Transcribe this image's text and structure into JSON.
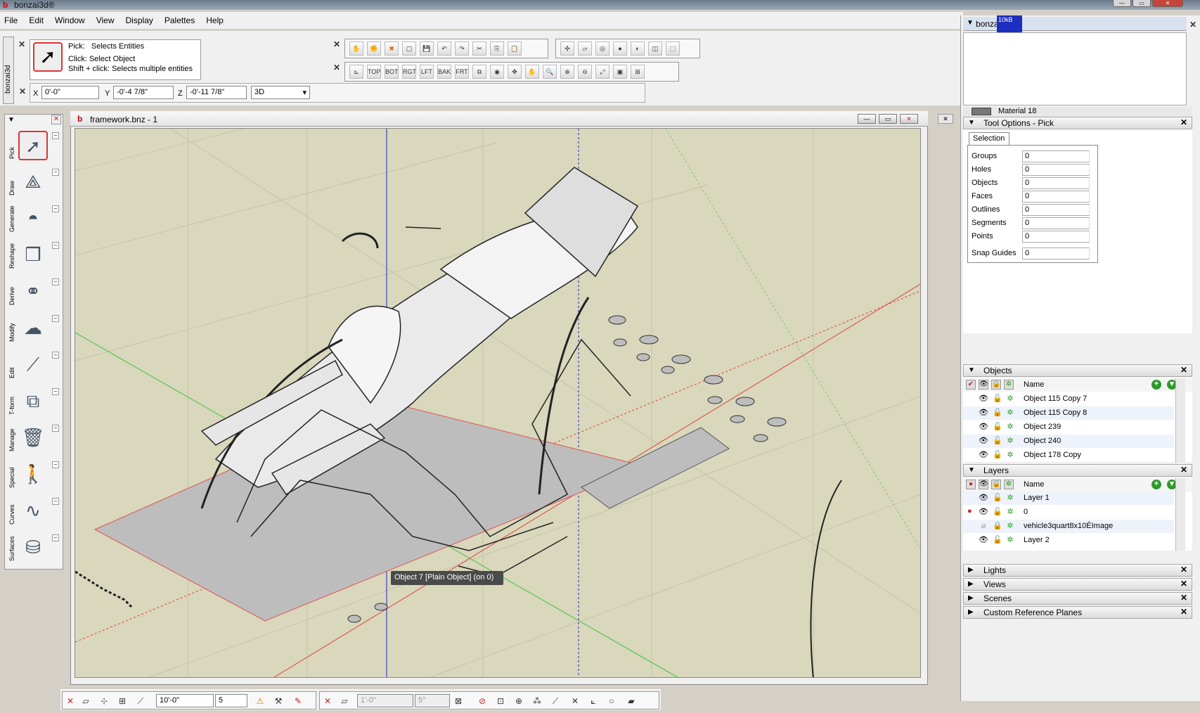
{
  "app": {
    "title": "bonzai3d®"
  },
  "menu": [
    "File",
    "Edit",
    "Window",
    "View",
    "Display",
    "Palettes",
    "Help"
  ],
  "sidebar_tab": "bonzai3d",
  "pick_panel": {
    "line1_label": "Pick:",
    "line1_value": "Selects Entities",
    "line2": "Click: Select Object",
    "line3": "Shift + click: Selects multiple entities"
  },
  "coords": {
    "x_label": "X",
    "x_value": "0'-0\"",
    "y_label": "Y",
    "y_value": "-0'-4 7/8\"",
    "z_label": "Z",
    "z_value": "-0'-11 7/8\"",
    "view_mode": "3D"
  },
  "view_toolbar": [
    "TOP",
    "BOT",
    "RGT",
    "LFT",
    "BAK",
    "FRT"
  ],
  "right_panel": {
    "header": "bonzai3d",
    "tab_badge": "10kB",
    "material_item": "Material 18",
    "tool_options": "Tool Options - Pick",
    "selection_tab": "Selection",
    "selection": [
      {
        "label": "Groups",
        "value": "0"
      },
      {
        "label": "Holes",
        "value": "0"
      },
      {
        "label": "Objects",
        "value": "0"
      },
      {
        "label": "Faces",
        "value": "0"
      },
      {
        "label": "Outlines",
        "value": "0"
      },
      {
        "label": "Segments",
        "value": "0"
      },
      {
        "label": "Points",
        "value": "0"
      }
    ],
    "snap_guides": {
      "label": "Snap Guides",
      "value": "0"
    },
    "objects_header": "Objects",
    "objects_name_col": "Name",
    "objects": [
      "Object 115 Copy 7",
      "Object 115 Copy 8",
      "Object 239",
      "Object 240",
      "Object 178 Copy"
    ],
    "layers_header": "Layers",
    "layers_name_col": "Name",
    "layers": [
      "Layer 1",
      "0",
      "vehicle3quart8x10ÉImage",
      "Layer 2"
    ],
    "collapsed": [
      "Lights",
      "Views",
      "Scenes",
      "Custom Reference Planes"
    ]
  },
  "toolbox": [
    "Pick",
    "Draw",
    "Generate",
    "Reshape",
    "Derive",
    "Modify",
    "Edit",
    "T-form",
    "Manage",
    "Special",
    "Curves",
    "Surfaces"
  ],
  "document": {
    "title": "framework.bnz - 1"
  },
  "tooltip": "Object 7 [Plain Object] (on 0)",
  "bottom_bar": {
    "grid_spacing": "10'-0\"",
    "grid_divisions": "5",
    "snap_distance": "1'-0\"",
    "snap_angle": "5°"
  }
}
